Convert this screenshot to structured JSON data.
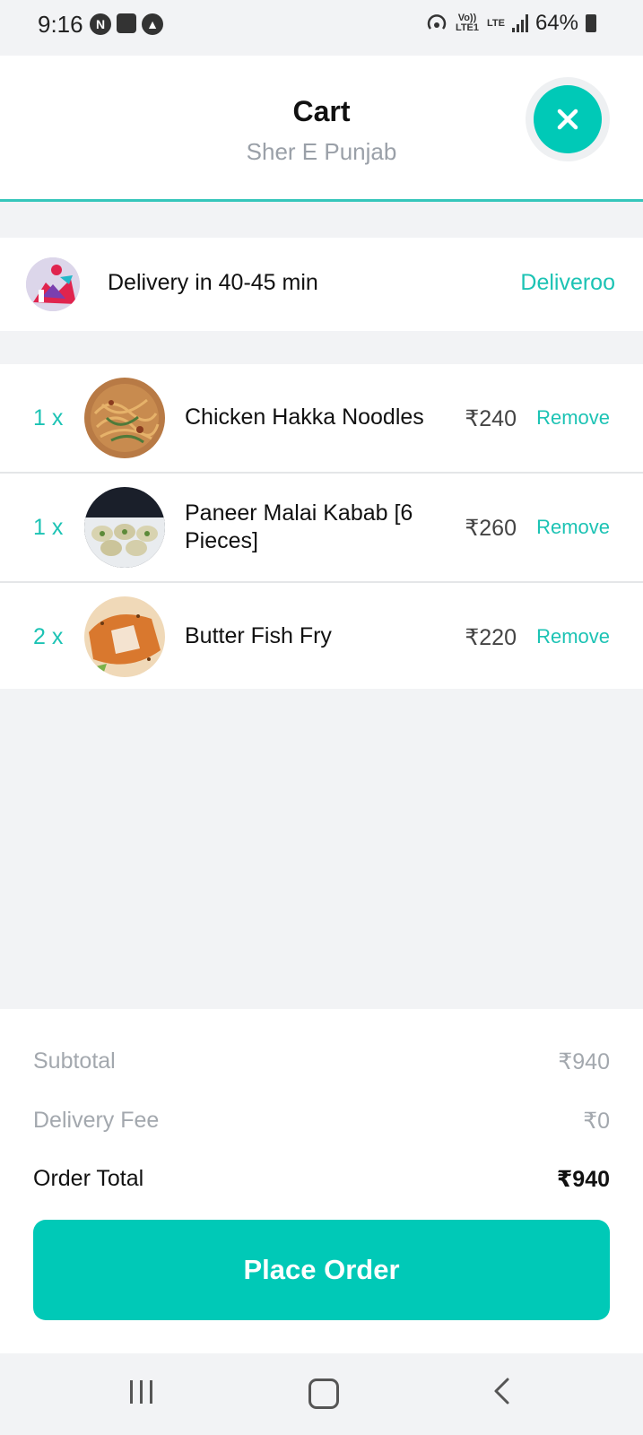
{
  "status_bar": {
    "time": "9:16",
    "left_icons": [
      "n-icon",
      "gallery-icon",
      "a-icon"
    ],
    "right_icons": [
      "hotspot-icon",
      "volte-icon",
      "lte-icon",
      "signal-icon",
      "battery-icon"
    ],
    "volte_label": "Vo)) LTE1",
    "lte_label": "LTE",
    "battery": "64%"
  },
  "header": {
    "title": "Cart",
    "subtitle": "Sher E Punjab"
  },
  "delivery": {
    "text": "Delivery in 40-45 min",
    "brand": "Deliveroo"
  },
  "items": [
    {
      "qty": "1 x",
      "name": "Chicken Hakka Noodles",
      "price": "₹240",
      "remove": "Remove"
    },
    {
      "qty": "1 x",
      "name": "Paneer Malai Kabab [6 Pieces]",
      "price": "₹260",
      "remove": "Remove"
    },
    {
      "qty": "2 x",
      "name": "Butter Fish Fry",
      "price": "₹220",
      "remove": "Remove"
    }
  ],
  "summary": {
    "subtotal_label": "Subtotal",
    "subtotal_value": "₹940",
    "delivery_fee_label": "Delivery Fee",
    "delivery_fee_value": "₹0",
    "order_total_label": "Order Total",
    "order_total_value": "₹940"
  },
  "place_order": "Place Order",
  "colors": {
    "accent": "#00c9b7",
    "accent_text": "#1cc3b4",
    "background": "#f2f3f5"
  }
}
